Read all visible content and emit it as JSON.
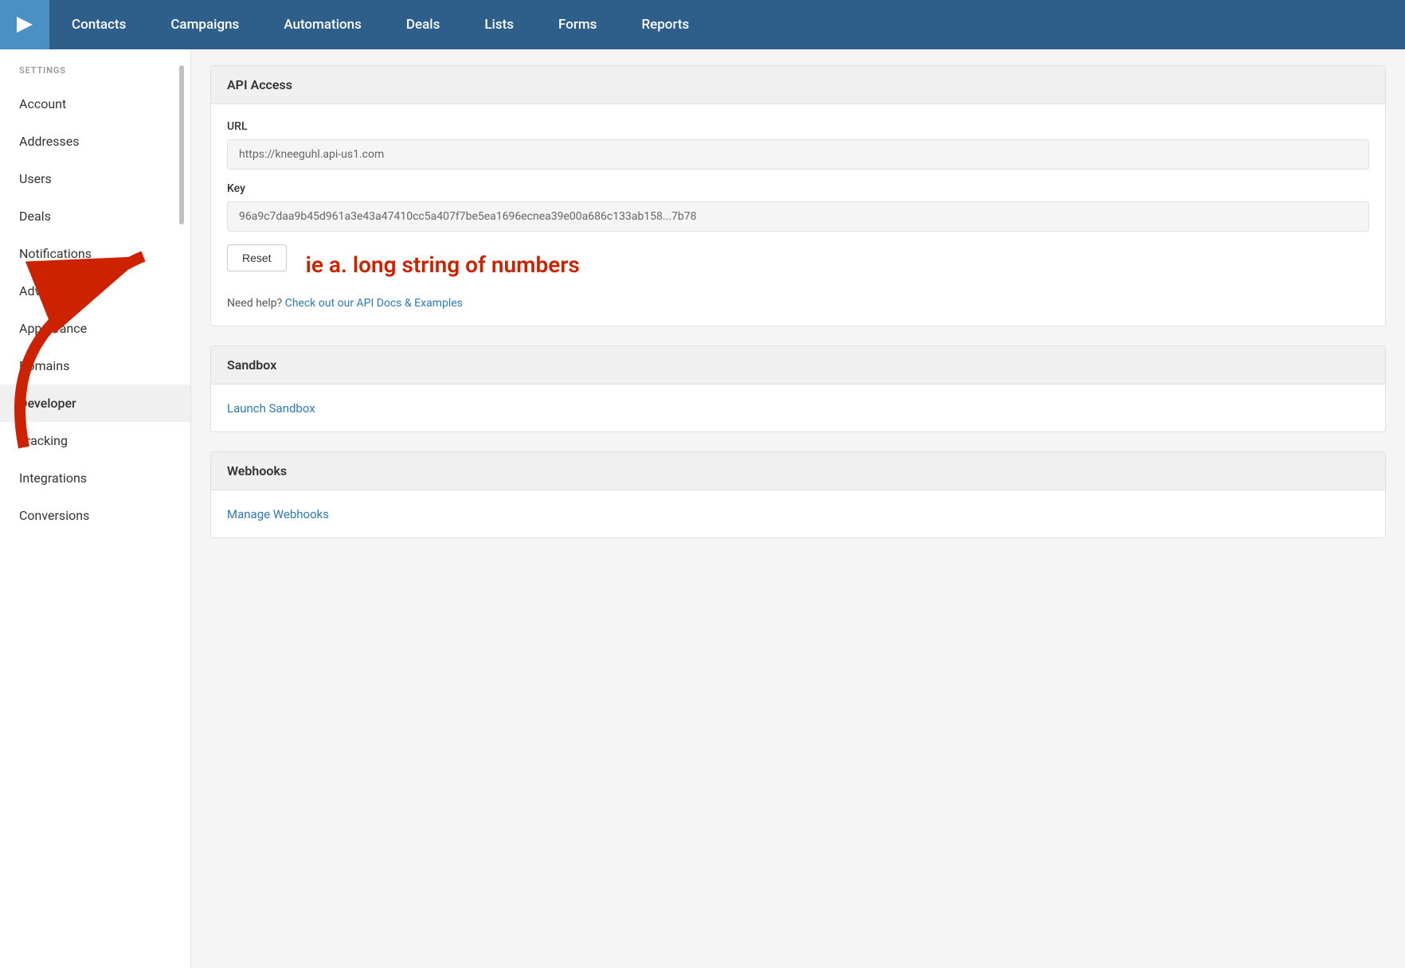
{
  "nav": {
    "logo_symbol": "▶",
    "items": [
      {
        "label": "Contacts",
        "id": "contacts"
      },
      {
        "label": "Campaigns",
        "id": "campaigns"
      },
      {
        "label": "Automations",
        "id": "automations"
      },
      {
        "label": "Deals",
        "id": "deals"
      },
      {
        "label": "Lists",
        "id": "lists"
      },
      {
        "label": "Forms",
        "id": "forms"
      },
      {
        "label": "Reports",
        "id": "reports"
      }
    ]
  },
  "sidebar": {
    "section_label": "SETTINGS",
    "items": [
      {
        "label": "Account",
        "id": "account",
        "active": false
      },
      {
        "label": "Addresses",
        "id": "addresses",
        "active": false
      },
      {
        "label": "Users",
        "id": "users",
        "active": false
      },
      {
        "label": "Deals",
        "id": "deals",
        "active": false
      },
      {
        "label": "Notifications",
        "id": "notifications",
        "active": false
      },
      {
        "label": "Advanced",
        "id": "advanced",
        "active": false
      },
      {
        "label": "Appearance",
        "id": "appearance",
        "active": false
      },
      {
        "label": "Domains",
        "id": "domains",
        "active": false
      },
      {
        "label": "Developer",
        "id": "developer",
        "active": true
      },
      {
        "label": "Tracking",
        "id": "tracking",
        "active": false
      },
      {
        "label": "Integrations",
        "id": "integrations",
        "active": false
      },
      {
        "label": "Conversions",
        "id": "conversions",
        "active": false
      }
    ]
  },
  "api_access": {
    "section_title": "API Access",
    "url_label": "URL",
    "url_value": "https://kneeguhl.api-us1.com",
    "key_label": "Key",
    "key_value": "96a9c7daa9b45d961a3e43a47410cc5a407f7be5ea1696ecnea39e00a686c133ab158...7b78",
    "reset_label": "Reset",
    "annotation": "ie a. long string of numbers",
    "help_text": "Need help?",
    "help_link_text": "Check out our API Docs & Examples",
    "help_link_href": "#"
  },
  "sandbox": {
    "section_title": "Sandbox",
    "launch_label": "Launch Sandbox",
    "launch_href": "#"
  },
  "webhooks": {
    "section_title": "Webhooks",
    "manage_label": "Manage Webhooks",
    "manage_href": "#"
  }
}
